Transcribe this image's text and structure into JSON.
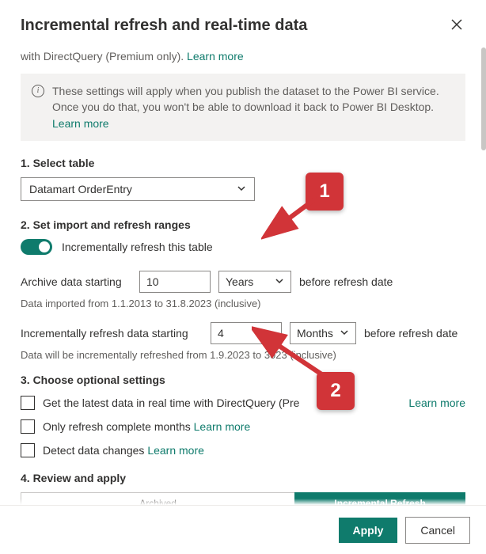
{
  "header": {
    "title": "Incremental refresh and real-time data"
  },
  "intro": {
    "prefix": "with DirectQuery (Premium only). ",
    "learn_more": "Learn more"
  },
  "infobox": {
    "text": "These settings will apply when you publish the dataset to the Power BI service. Once you do that, you won't be able to download it back to Power BI Desktop. ",
    "learn_more": "Learn more"
  },
  "sections": {
    "s1": "1. Select table",
    "s2": "2. Set import and refresh ranges",
    "s3": "3. Choose optional settings",
    "s4": "4. Review and apply"
  },
  "table_select": {
    "value": "Datamart OrderEntry"
  },
  "toggle": {
    "label": "Incrementally refresh this table",
    "on": true
  },
  "archive": {
    "label": "Archive data starting",
    "value": "10",
    "unit": "Years",
    "after": "before refresh date",
    "hint": "Data imported from 1.1.2013 to 31.8.2023 (inclusive)"
  },
  "incremental": {
    "label": "Incrementally refresh data starting",
    "value": "4",
    "unit": "Months",
    "after": "before refresh date",
    "hint_pre": "Data will be incrementally refreshed from 1.9.2023 to 3",
    "hint_post": "023 (inclusive)"
  },
  "optional": {
    "o1": "Get the latest data in real time with DirectQuery (Pre",
    "o1_learn": "Learn more",
    "o2": "Only refresh complete months ",
    "o2_learn": "Learn more",
    "o3": "Detect data changes ",
    "o3_learn": "Learn more"
  },
  "review": {
    "archived_label": "Archived",
    "refresh_label": "Incremental Refresh"
  },
  "footer": {
    "apply": "Apply",
    "cancel": "Cancel"
  },
  "callouts": {
    "c1": "1",
    "c2": "2"
  }
}
